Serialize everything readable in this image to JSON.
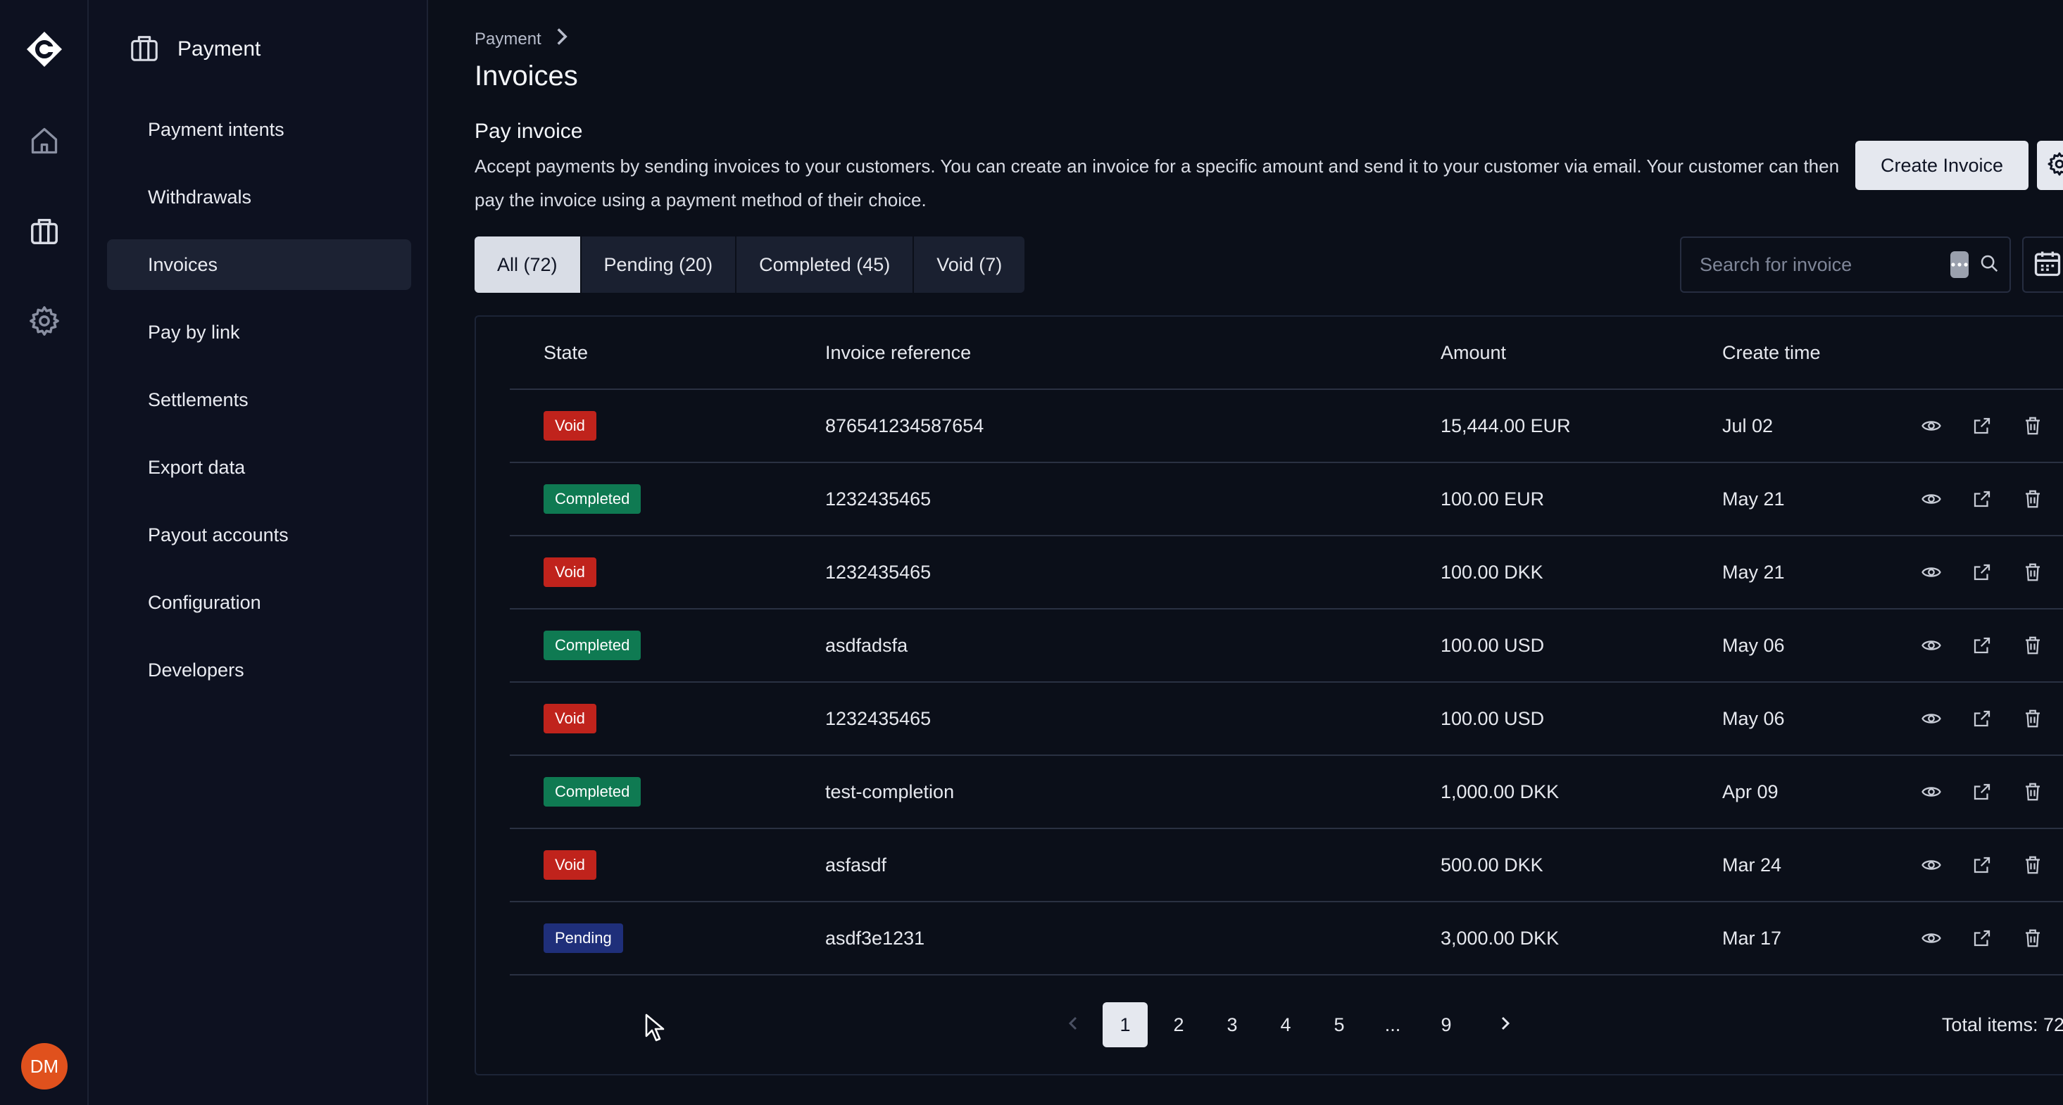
{
  "sidebar": {
    "title": "Payment",
    "items": [
      {
        "label": "Payment intents",
        "active": false
      },
      {
        "label": "Withdrawals",
        "active": false
      },
      {
        "label": "Invoices",
        "active": true
      },
      {
        "label": "Pay by link",
        "active": false
      },
      {
        "label": "Settlements",
        "active": false
      },
      {
        "label": "Export data",
        "active": false
      },
      {
        "label": "Payout accounts",
        "active": false
      },
      {
        "label": "Configuration",
        "active": false
      },
      {
        "label": "Developers",
        "active": false
      }
    ]
  },
  "user": {
    "initials": "DM",
    "avatar_color": "#e0511d"
  },
  "breadcrumb": {
    "parent": "Payment"
  },
  "page": {
    "title": "Invoices",
    "section_title": "Pay invoice",
    "description": "Accept payments by sending invoices to your customers. You can create an invoice for a specific amount and send it to your customer via email. Your customer can then pay the invoice using a payment method of their choice.",
    "create_label": "Create Invoice"
  },
  "tabs": [
    {
      "label": "All (72)",
      "active": true
    },
    {
      "label": "Pending (20)",
      "active": false
    },
    {
      "label": "Completed (45)",
      "active": false
    },
    {
      "label": "Void (7)",
      "active": false
    }
  ],
  "search": {
    "placeholder": "Search for invoice",
    "value": ""
  },
  "table": {
    "columns": {
      "state": "State",
      "reference": "Invoice reference",
      "amount": "Amount",
      "created": "Create time"
    },
    "rows": [
      {
        "state": "Void",
        "reference": "876541234587654",
        "amount": "15,444.00 EUR",
        "created": "Jul 02"
      },
      {
        "state": "Completed",
        "reference": "1232435465",
        "amount": "100.00 EUR",
        "created": "May 21"
      },
      {
        "state": "Void",
        "reference": "1232435465",
        "amount": "100.00 DKK",
        "created": "May 21"
      },
      {
        "state": "Completed",
        "reference": "asdfadsfa",
        "amount": "100.00 USD",
        "created": "May 06"
      },
      {
        "state": "Void",
        "reference": "1232435465",
        "amount": "100.00 USD",
        "created": "May 06"
      },
      {
        "state": "Completed",
        "reference": "test-completion",
        "amount": "1,000.00 DKK",
        "created": "Apr 09"
      },
      {
        "state": "Void",
        "reference": "asfasdf",
        "amount": "500.00 DKK",
        "created": "Mar 24"
      },
      {
        "state": "Pending",
        "reference": "asdf3e1231",
        "amount": "3,000.00 DKK",
        "created": "Mar 17"
      }
    ],
    "row_actions": [
      "eye-icon",
      "external-link-icon",
      "trash-icon"
    ]
  },
  "pagination": {
    "pages": [
      "1",
      "2",
      "3",
      "4",
      "5",
      "...",
      "9"
    ],
    "current": "1",
    "total_label": "Total items: 72"
  },
  "colors": {
    "void": "#c0231c",
    "completed": "#0f7a52",
    "pending": "#1f2f7a",
    "background": "#0b0f19"
  }
}
